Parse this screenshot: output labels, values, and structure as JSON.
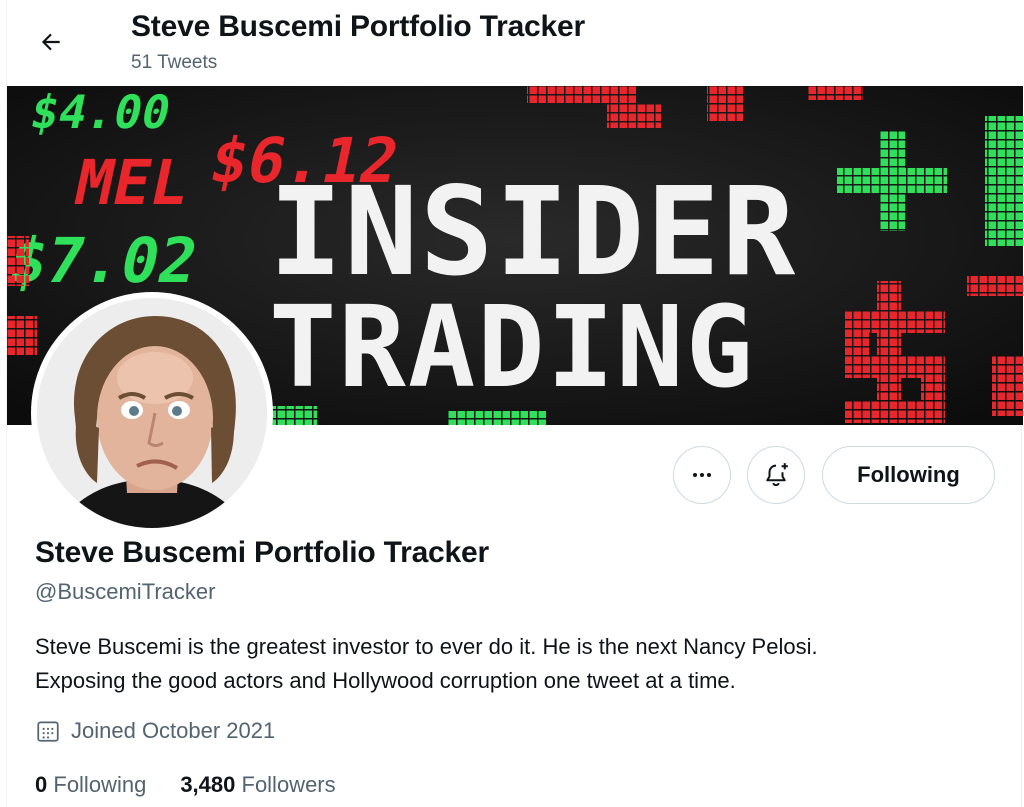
{
  "header": {
    "title": "Steve Buscemi Portfolio Tracker",
    "tweet_count": "51 Tweets"
  },
  "banner": {
    "headline_1": "INSIDER",
    "headline_2": "TRADING",
    "ticker_values": [
      "$4.00",
      "MEL",
      "$6.12",
      "$7.02"
    ],
    "colors": {
      "green": "#2ee05a",
      "red": "#e8262b",
      "white": "#f2f2f2",
      "background": "#161616"
    }
  },
  "profile": {
    "name": "Steve Buscemi Portfolio Tracker",
    "handle": "@BuscemiTracker",
    "bio_line1": "Steve Buscemi is the greatest investor to ever do it. He is the next Nancy Pelosi.",
    "bio_line2": "Exposing the good actors and Hollywood corruption one tweet at a time.",
    "joined": "Joined October 2021"
  },
  "actions": {
    "more_icon": "more-horizontal-icon",
    "bell_icon": "bell-plus-icon",
    "following_label": "Following"
  },
  "stats": {
    "following_count": "0",
    "following_label": "Following",
    "followers_count": "3,480",
    "followers_label": "Followers"
  }
}
